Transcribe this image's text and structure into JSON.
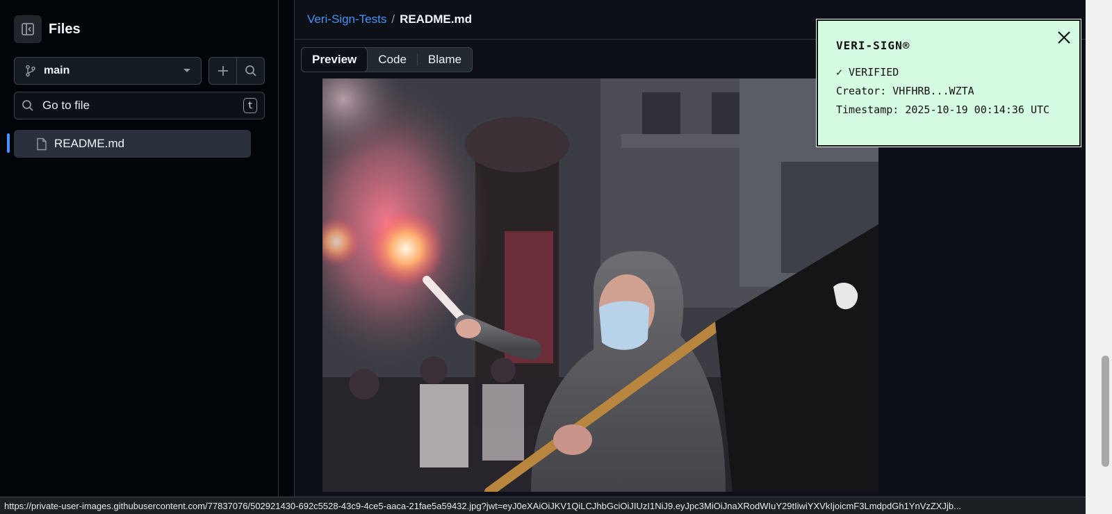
{
  "sidebar": {
    "title": "Files",
    "branch": "main",
    "goto_placeholder": "Go to file",
    "goto_shortcut": "t",
    "tree": [
      {
        "label": "README.md",
        "selected": true
      }
    ]
  },
  "breadcrumb": {
    "repo": "Veri-Sign-Tests",
    "separator": "/",
    "file": "README.md"
  },
  "tabs": [
    {
      "label": "Preview",
      "selected": true
    },
    {
      "label": "Code",
      "selected": false
    },
    {
      "label": "Blame",
      "selected": false
    }
  ],
  "popup": {
    "title": "VERI-SIGN®",
    "status": "✓ VERIFIED",
    "creator": "Creator: VHFHRB...WZTA",
    "timestamp": "Timestamp: 2025-10-19 00:14:36 UTC"
  },
  "status_url": "https://private-user-images.githubusercontent.com/77837076/502921430-692c5528-43c9-4ce5-aaca-21fae5a59432.jpg?jwt=eyJ0eXAiOiJKV1QiLCJhbGciOiJIUzI1NiJ9.eyJpc3MiOiJnaXRodWIuY29tIiwiYXVkIjoicmF3LmdpdGh1YnVzZXJjb...",
  "colors": {
    "accent": "#4493f8",
    "popup_bg": "#d6fbe3"
  }
}
